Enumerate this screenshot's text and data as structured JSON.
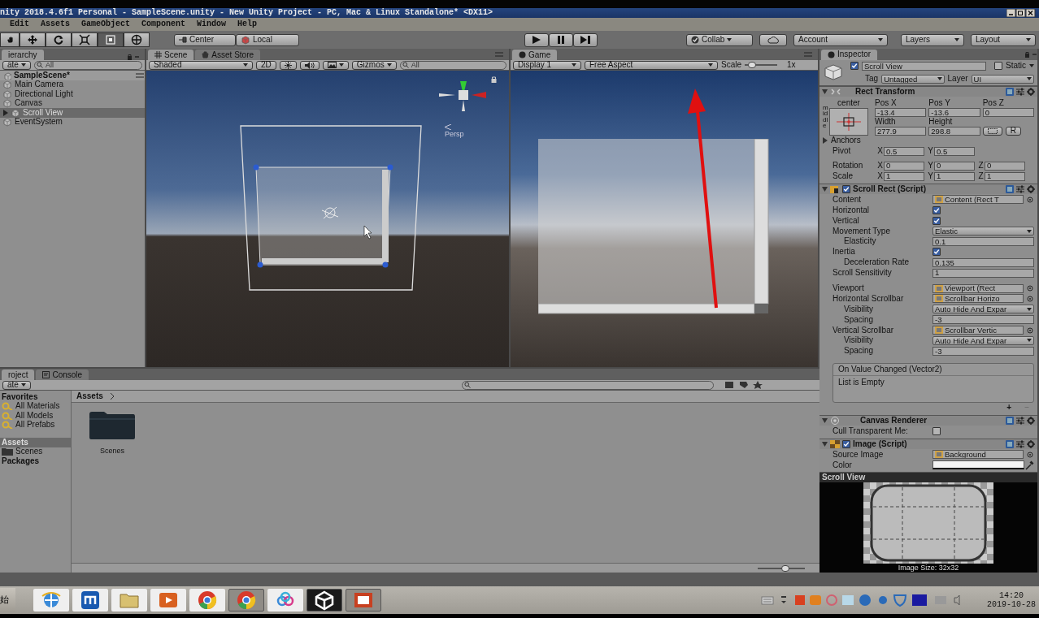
{
  "window": {
    "title": "nity 2018.4.6f1 Personal - SampleScene.unity - New Unity Project - PC, Mac & Linux Standalone* <DX11>"
  },
  "menu": [
    "Edit",
    "Assets",
    "GameObject",
    "Component",
    "Window",
    "Help"
  ],
  "toolbar": {
    "tools": [
      {
        "kind": "hand",
        "selected": false
      },
      {
        "kind": "move",
        "selected": false
      },
      {
        "kind": "rotate",
        "selected": false
      },
      {
        "kind": "scale",
        "selected": false
      },
      {
        "kind": "rect",
        "selected": true
      },
      {
        "kind": "transform",
        "selected": false
      }
    ],
    "pivot": "Center",
    "space": "Local",
    "collab": "Collab",
    "account": "Account",
    "layers": "Layers",
    "layout": "Layout"
  },
  "hierarchy": {
    "tab": "ierarchy",
    "create": "ate",
    "search_placeholder": "All",
    "scene": "SampleScene*",
    "items": [
      {
        "label": "Main Camera",
        "selected": false,
        "has_children": false
      },
      {
        "label": "Directional Light",
        "selected": false,
        "has_children": false
      },
      {
        "label": "Canvas",
        "selected": false,
        "has_children": false
      },
      {
        "label": "Scroll View",
        "selected": true,
        "has_children": true
      },
      {
        "label": "EventSystem",
        "selected": false,
        "has_children": false
      }
    ]
  },
  "scene": {
    "tabs": [
      {
        "label": "Scene",
        "selected": true
      },
      {
        "label": "Asset Store",
        "selected": false
      }
    ],
    "shading": "Shaded",
    "mode_2d": "2D",
    "gizmos": "Gizmos",
    "search_placeholder": "All",
    "projection": "Persp"
  },
  "game": {
    "tab": "Game",
    "display": "Display 1",
    "aspect": "Free Aspect",
    "scale_label": "Scale",
    "scale": {
      "level": 0.12
    },
    "scale_value": "1x"
  },
  "inspector": {
    "tab": "Inspector",
    "object": {
      "enabled": true,
      "name": "Scroll View",
      "static_label": "Static",
      "static": false,
      "tag_label": "Tag",
      "tag": "Untagged",
      "layer_label": "Layer",
      "layer": "UI"
    },
    "rect_transform": {
      "title": "Rect Transform",
      "anchor_h": "center",
      "anchor_v": "middle",
      "fields": [
        {
          "label": "Pos X",
          "value": "-13.4"
        },
        {
          "label": "Pos Y",
          "value": "-13.6"
        },
        {
          "label": "Pos Z",
          "value": "0"
        },
        {
          "label": "Width",
          "value": "277.9"
        },
        {
          "label": "Height",
          "value": "298.8"
        }
      ],
      "raw_button": "R",
      "anchors": "Anchors",
      "rows": [
        {
          "label": "Pivot",
          "parts": [
            {
              "axis": "X",
              "value": "0.5"
            },
            {
              "axis": "Y",
              "value": "0.5"
            }
          ]
        },
        {
          "label": "Rotation",
          "parts": [
            {
              "axis": "X",
              "value": "0"
            },
            {
              "axis": "Y",
              "value": "0"
            },
            {
              "axis": "Z",
              "value": "0"
            }
          ]
        },
        {
          "label": "Scale",
          "parts": [
            {
              "axis": "X",
              "value": "1"
            },
            {
              "axis": "Y",
              "value": "1"
            },
            {
              "axis": "Z",
              "value": "1"
            }
          ]
        }
      ]
    },
    "components": [
      {
        "title": "Scroll Rect (Script)",
        "kind": "script",
        "enabled": true,
        "groups": [
          {
            "rows": [
              {
                "kind": "object",
                "label": "Content",
                "value": "Content (Rect T",
                "indented": false
              },
              {
                "kind": "check",
                "label": "Horizontal",
                "checked": true,
                "indented": false
              },
              {
                "kind": "check",
                "label": "Vertical",
                "checked": true,
                "indented": false
              },
              {
                "kind": "dropdown",
                "label": "Movement Type",
                "value": "Elastic",
                "indented": false
              },
              {
                "kind": "text",
                "label": "Elasticity",
                "value": "0.1",
                "indented": true
              },
              {
                "kind": "check",
                "label": "Inertia",
                "checked": true,
                "indented": false
              },
              {
                "kind": "text",
                "label": "Deceleration Rate",
                "value": "0.135",
                "indented": true
              },
              {
                "kind": "text",
                "label": "Scroll Sensitivity",
                "value": "1",
                "indented": false
              }
            ]
          },
          {
            "rows": [
              {
                "kind": "object",
                "label": "Viewport",
                "value": "Viewport (Rect",
                "indented": false
              },
              {
                "kind": "object",
                "label": "Horizontal Scrollbar",
                "value": "Scrollbar Horizo",
                "indented": false
              },
              {
                "kind": "dropdown",
                "label": "Visibility",
                "value": "Auto Hide And Expar",
                "indented": true
              },
              {
                "kind": "text",
                "label": "Spacing",
                "value": "-3",
                "indented": true
              },
              {
                "kind": "object",
                "label": "Vertical Scrollbar",
                "value": "Scrollbar Vertic",
                "indented": false
              },
              {
                "kind": "dropdown",
                "label": "Visibility",
                "value": "Auto Hide And Expar",
                "indented": true
              },
              {
                "kind": "text",
                "label": "Spacing",
                "value": "-3",
                "indented": true
              }
            ]
          }
        ],
        "event": {
          "title": "On Value Changed (Vector2)",
          "empty": "List is Empty",
          "add": "+",
          "remove": "−"
        }
      },
      {
        "title": "Canvas Renderer",
        "kind": "renderer",
        "groups": [
          {
            "rows": [
              {
                "kind": "check",
                "label": "Cull Transparent Me:",
                "checked": false,
                "indented": false
              }
            ]
          }
        ]
      },
      {
        "title": "Image (Script)",
        "kind": "image",
        "enabled": true,
        "groups": [
          {
            "rows": [
              {
                "kind": "object",
                "label": "Source Image",
                "value": "Background",
                "indented": false
              },
              {
                "kind": "color",
                "label": "Color",
                "indented": false
              }
            ]
          }
        ]
      }
    ],
    "preview": {
      "title": "Scroll View",
      "caption": "Image Size: 32x32"
    }
  },
  "project": {
    "tabs": [
      {
        "label": "roject",
        "selected": true
      },
      {
        "label": "Console",
        "selected": false
      }
    ],
    "create": "ate",
    "sidebar": [
      {
        "label": "Favorites",
        "selected": false,
        "children": [
          {
            "label": "All Materials",
            "selected": false
          },
          {
            "label": "All Models",
            "selected": false
          },
          {
            "label": "All Prefabs",
            "selected": false
          }
        ]
      },
      {
        "label": "Assets",
        "selected": true,
        "children": [
          {
            "label": "Scenes",
            "selected": false
          }
        ]
      },
      {
        "label": "Packages",
        "selected": false
      }
    ],
    "breadcrumb": "Assets",
    "assets": [
      {
        "label": "Scenes"
      }
    ],
    "zoom": {
      "level": 0.6
    }
  },
  "taskbar": {
    "start": "始",
    "apps": [
      {
        "kind": "browser",
        "active": false
      },
      {
        "kind": "m-app",
        "active": false
      },
      {
        "kind": "folder",
        "active": false
      },
      {
        "kind": "media",
        "active": false
      },
      {
        "kind": "chrome",
        "active": false
      },
      {
        "kind": "chrome",
        "active": true
      },
      {
        "kind": "cloud",
        "active": false
      },
      {
        "kind": "unity",
        "active": true
      },
      {
        "kind": "slides",
        "active": true
      }
    ],
    "time": "14:20",
    "date": "2019-10-28"
  }
}
